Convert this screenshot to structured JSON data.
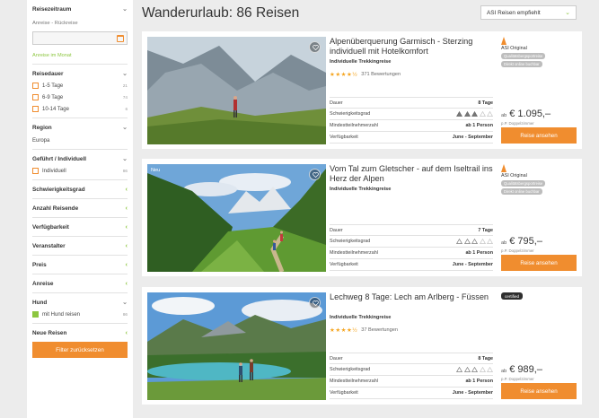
{
  "page": {
    "title": "Wanderurlaub:  86 Reisen",
    "sort": "ASI Reisen empfiehlt"
  },
  "sidebar": {
    "travel_period": {
      "label": "Reisezeitraum",
      "sub": "Anreise - Rückreise",
      "link": "Anreise im Monat"
    },
    "duration": {
      "label": "Reisedauer",
      "options": [
        {
          "label": "1-5 Tage",
          "count": "21"
        },
        {
          "label": "6-9 Tage",
          "count": "74"
        },
        {
          "label": "10-14 Tage",
          "count": "6"
        }
      ]
    },
    "region": {
      "label": "Region",
      "value": "Europa"
    },
    "guided": {
      "label": "Geführt / Individuell",
      "option": "Individuell",
      "count": "86"
    },
    "difficulty": {
      "label": "Schwierigkeitsgrad"
    },
    "participants": {
      "label": "Anzahl Reisende"
    },
    "availability": {
      "label": "Verfügbarkeit"
    },
    "organizer": {
      "label": "Veranstalter"
    },
    "price": {
      "label": "Preis"
    },
    "arrival": {
      "label": "Anreise"
    },
    "dog": {
      "label": "Hund",
      "option": "mit Hund reisen",
      "count": "86"
    },
    "new_trips": {
      "label": "Neue Reisen"
    },
    "reset": "Filter zurücksetzen"
  },
  "cards": [
    {
      "title": "Alpenüberquerung Garmisch - Sterzing individuell mit Hotelkomfort",
      "subtitle": "Individuelle Trekkingreise",
      "reviews": "371 Bewertungen",
      "rating": "4.5",
      "brand": "ASI Original",
      "pills": [
        "Qualitätsbergsportreise",
        "Direkt online buchbar"
      ],
      "facts": {
        "duration_label": "Dauer",
        "duration": "8 Tage",
        "difficulty_label": "Schwierigkeitsgrad",
        "difficulty_level": 3,
        "difficulty_max": 5,
        "min_label": "Mindestteilnehmerzahl",
        "min": "ab 1 Person",
        "avail_label": "Verfügbarkeit",
        "avail": "June - September"
      },
      "price_prefix": "ab",
      "price": "€ 1.095,–",
      "price_note": "p.P. Doppelzimmer",
      "cta": "Reise ansehen"
    },
    {
      "badge": "Neu",
      "title": "Vom Tal zum Gletscher - auf dem Iseltrail ins Herz der Alpen",
      "subtitle": "Individuelle Trekkingreise",
      "brand": "ASI Original",
      "pills": [
        "Qualitätsbergsportreise",
        "Direkt online buchbar"
      ],
      "facts": {
        "duration_label": "Dauer",
        "duration": "7 Tage",
        "difficulty_label": "Schwierigkeitsgrad",
        "difficulty_level": 0,
        "difficulty_max": 5,
        "min_label": "Mindestteilnehmerzahl",
        "min": "ab 1 Person",
        "avail_label": "Verfügbarkeit",
        "avail": "June - September"
      },
      "price_prefix": "ab",
      "price": "€ 795,–",
      "price_note": "p.P. Doppelzimmer",
      "cta": "Reise ansehen"
    },
    {
      "title": "Lechweg 8 Tage: Lech am Arlberg - Füssen",
      "subtitle": "Individuelle Trekkingreise",
      "reviews": "37 Bewertungen",
      "rating": "4.5",
      "certified": "certified",
      "facts": {
        "duration_label": "Dauer",
        "duration": "8 Tage",
        "difficulty_label": "Schwierigkeitsgrad",
        "difficulty_level": 0,
        "difficulty_max": 5,
        "min_label": "Mindestteilnehmerzahl",
        "min": "ab 1 Person",
        "avail_label": "Verfügbarkeit",
        "avail": "June - September"
      },
      "price_prefix": "ab",
      "price": "€ 989,–",
      "price_note": "p.P. Doppelzimmer",
      "cta": "Reise ansehen"
    }
  ],
  "colors": {
    "accent": "#f08d2f",
    "green": "#8cc63f",
    "stars": "#f5a623"
  },
  "icons": [
    "calendar-icon",
    "chevron-down-icon",
    "heart-icon",
    "star-icon",
    "difficulty-triangle-icon",
    "asi-logo-icon"
  ]
}
